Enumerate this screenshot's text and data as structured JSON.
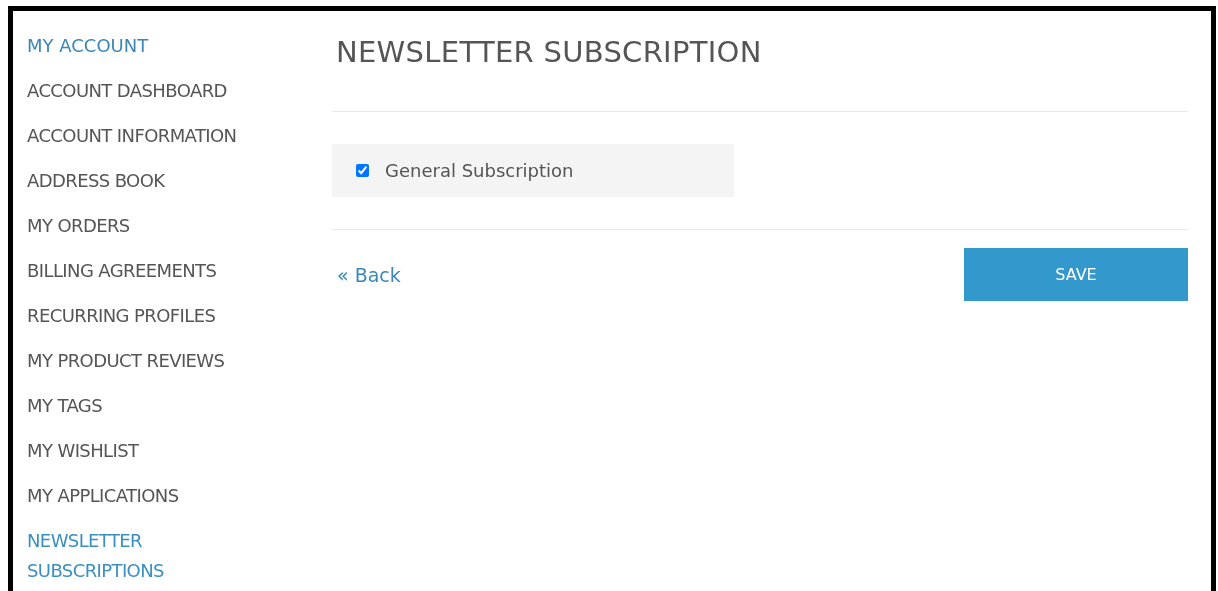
{
  "sidebar": {
    "title": "MY ACCOUNT",
    "items": [
      {
        "label": "ACCOUNT DASHBOARD",
        "selected": false
      },
      {
        "label": "ACCOUNT INFORMATION",
        "selected": false
      },
      {
        "label": "ADDRESS BOOK",
        "selected": false
      },
      {
        "label": "MY ORDERS",
        "selected": false
      },
      {
        "label": "BILLING AGREEMENTS",
        "selected": false
      },
      {
        "label": "RECURRING PROFILES",
        "selected": false
      },
      {
        "label": "MY PRODUCT REVIEWS",
        "selected": false
      },
      {
        "label": "MY TAGS",
        "selected": false
      },
      {
        "label": "MY WISHLIST",
        "selected": false
      },
      {
        "label": "MY APPLICATIONS",
        "selected": false
      },
      {
        "label": "NEWSLETTER SUBSCRIPTIONS",
        "selected": true
      }
    ]
  },
  "main": {
    "heading": "NEWSLETTER SUBSCRIPTION",
    "subscription": {
      "label": "General Subscription",
      "checked": true
    },
    "back_link": "« Back",
    "save_button": "SAVE"
  }
}
